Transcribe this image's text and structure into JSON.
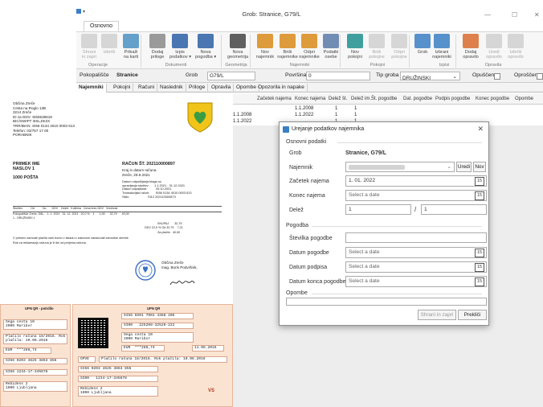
{
  "window": {
    "title": "Grob: Stranice, G79/L",
    "quick_access": "▾",
    "min": "—",
    "max": "☐",
    "close": "✕"
  },
  "ribbon": {
    "tab": "Osnovno",
    "buttons": [
      {
        "label": "Shrani\nin zapri",
        "icon": "save-close-icon",
        "enabled": false
      },
      {
        "label": "Izbriši",
        "icon": "delete-icon",
        "enabled": false
      },
      {
        "label": "Prikaži\nna karti",
        "icon": "map-icon",
        "enabled": true
      },
      {
        "label": "Dodaj\npriloge",
        "icon": "attachment-icon",
        "enabled": true
      },
      {
        "label": "Izpis\npodatkov ▾",
        "icon": "word-print-icon",
        "enabled": true
      },
      {
        "label": "Nova\npogodba ▾",
        "icon": "word-new-icon",
        "enabled": true
      },
      {
        "label": "Nova\ngeometrija",
        "icon": "geometry-icon",
        "enabled": true
      },
      {
        "label": "Nov\nnajemnik",
        "icon": "add-tenant-icon",
        "enabled": true
      },
      {
        "label": "Briši\nnajemnike",
        "icon": "delete-tenant-icon",
        "enabled": true
      },
      {
        "label": "Odpri\nnajemnike",
        "icon": "open-tenant-icon",
        "enabled": true
      },
      {
        "label": "Podatki\nosebe",
        "icon": "person-data-icon",
        "enabled": true
      },
      {
        "label": "Nov\npokojni",
        "icon": "add-deceased-icon",
        "enabled": true
      },
      {
        "label": "Briši\npokojne",
        "icon": "delete-deceased-icon",
        "enabled": false
      },
      {
        "label": "Odpri\npokojne",
        "icon": "open-deceased-icon",
        "enabled": false
      },
      {
        "label": "Grob",
        "icon": "grave-icon",
        "enabled": true
      },
      {
        "label": "Izbrani\nnajemniki",
        "icon": "selected-tenants-icon",
        "enabled": true
      },
      {
        "label": "Dodaj\nopravilo",
        "icon": "add-task-icon",
        "enabled": true
      },
      {
        "label": "Uredi\nopravilo",
        "icon": "edit-task-icon",
        "enabled": false
      },
      {
        "label": "Izbriši\nopravilo",
        "icon": "delete-task-icon",
        "enabled": false
      }
    ],
    "groups": [
      "Operacije",
      "Dokumenti",
      "Geometrija",
      "Najemniki",
      "Pokojni",
      "Izpisi",
      "Opravila"
    ]
  },
  "filter": {
    "pokopalisce_label": "Pokopališče",
    "pokopalisce_value": "Stranice",
    "grob_label": "Grob",
    "grob_value": "G79/L",
    "povrsina_label": "Površina",
    "povrsina_value": "0",
    "tip_label": "Tip groba",
    "tip_value": "DRUŽINSKI",
    "opuscen_label": "Opuščen",
    "oprosten_label": "Oproščen"
  },
  "subtabs": [
    "Najemniki",
    "Pokojni",
    "Računi",
    "Naslednik",
    "Priloge",
    "Opravila",
    "Opombe",
    "Opozorila in napake"
  ],
  "grid": {
    "columns": [
      "Začetek najema",
      "Konec najema",
      "Delež št.",
      "Delež im.",
      "Št. pogodbe",
      "Dat. pogodbe",
      "Podpis pogodbe",
      "Konec pogodbe",
      "Opombe"
    ],
    "rows": [
      [
        "",
        "1.1.2008",
        "1",
        "1"
      ],
      [
        "1.1.2008",
        "1.1.2022",
        "1",
        "1"
      ],
      [
        "1.1.2022",
        "",
        "1",
        "1"
      ]
    ]
  },
  "dialog": {
    "title": "Urejanje podatkov najemnika",
    "section_basic": "Osnovni podatki",
    "grob_label": "Grob",
    "grob_value": "Stranice, G79/L",
    "najemnik_label": "Najemnik",
    "uredi": "Uredi",
    "nov": "Nov",
    "zacetek_label": "Začetek najema",
    "zacetek_value": "1. 01. 2022",
    "konec_label": "Konec najema",
    "placeholder_date": "Select a date",
    "delez_label": "Delež",
    "delez_num": "1",
    "delez_sep": "/",
    "delez_den": "1",
    "section_contract": "Pogodba",
    "stevilka_label": "Številka pogodbe",
    "datum_label": "Datum pogodbe",
    "podpis_label": "Datum podpisa",
    "konec_pog_label": "Datum konca pogodbe",
    "section_note": "Opombe",
    "save_close": "Shrani in zapri",
    "cancel": "Prekliči",
    "cal_num": "15"
  },
  "document": {
    "sender": "Občina Zreče\nCesta na Roglo 13B\n3214 Zreče\nID za DDV: SI55538519\nBIC/SWIFT: BSLJSI2X\nTRR/IBAN: SI56 0134 4010 0003 613\nTelefon: 03/757 17 00\nPORABNIK",
    "recipient": "PRIIMEK IME\nNASLOV 1\n\n1000 POŠTA",
    "invoice_title": "RAČUN ŠT. 202110000897",
    "invoice_meta": "Kraj in datum računa\nZreče, 29.9.2021",
    "invoice_details": "Datum odpošiljanja blaga oz.\nopravljanja storitev:      1.1.2021 - 31.12.2021\nDatum zapadlosti:          25.10.2021\nTransakcijski račun:       SI56 0134 4010 0003 613\nSklic:                     SI12 202110000873",
    "table_head": "Storitev          Od          Do       DDV    Delež   Količina   Cena brez DDV   Vrednost",
    "table_row": "Pokopališče Zreče, G8L-   1. 1. 2021   31. 12. 2021   22,0 %    1      1,00      32,79      40,00\n1 - DRUŽINSKI 1",
    "table_sum1": "SKUPAJ       32,79",
    "table_sum2": "DDV 22,0 % Od 32,79    7,21",
    "table_sum3": "Za plačilo   40,00",
    "note1": "V primeru zamude plačila vam bomo v skladu z zakonom zaračunali zamudne obresti.",
    "note2": "Rok za reklamacijo računa je 8 dni od prejema računa.",
    "signer": "Občina Zreče\nmag. Boris Podvršnik,",
    "slip_title_a": "UPN QR - potrdilo",
    "slip_title_b": "UPN QR",
    "slip_a_payer": "Sega cesta 10\n2000 Maribor",
    "slip_a_purpose": "Plačilo računa 18/2016. Rok\nplačila: 10.06.2016",
    "slip_a_amount": "EUR  ***260,74",
    "slip_a_iban": "SI56 0203 4625 3863 856",
    "slip_a_ref": "SI56 1234-17-345678",
    "slip_a_recv": "Rebidens 2\n1000 Ljubljana",
    "slip_b_iban": "SI56 0201 7001 4368 205",
    "slip_b_ref": "SI00   225208-32526-222",
    "slip_b_payer": "Sega cesta 10\n2000 Maribor",
    "slip_b_amount": "EUR  ***260,74",
    "slip_b_date": "11.05.2016",
    "slip_b_code": "GPVE",
    "slip_b_purpose": "Plačilo računa 18/2016. Rok plačila: 10.06.2016",
    "slip_b_iban2": "SI56 0203 4625 3863 856",
    "slip_b_ref2": "SI00   1234-17-345678",
    "slip_b_recv": "Rebidens 2\n1000 Ljubljana",
    "slip_vs": "VS"
  },
  "colors": {
    "accent": "#3b7fc4",
    "shield_fill": "#f0c419",
    "shield_heart": "#3a9d43",
    "slip_bg": "#fbe3d2"
  }
}
